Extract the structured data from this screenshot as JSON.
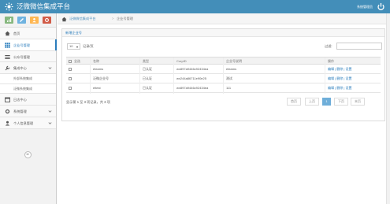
{
  "header": {
    "brand": "泛微微信集成平台",
    "user": "系统管理员",
    "colors": {
      "topbar": "#438eb9",
      "accent": "#2b7dbc"
    }
  },
  "sidebar": {
    "shortcuts": [
      {
        "icon": "signal-icon",
        "color": "#87b87f"
      },
      {
        "icon": "pencil-icon",
        "color": "#6fb3e0"
      },
      {
        "icon": "users-icon",
        "color": "#ffb752"
      },
      {
        "icon": "gear-icon",
        "color": "#d15b47"
      }
    ],
    "items": [
      {
        "label": "首页",
        "icon": "home-icon"
      },
      {
        "label": "企业号管理",
        "icon": "grid-icon",
        "active": true
      },
      {
        "label": "公众号管理",
        "icon": "list-icon"
      },
      {
        "label": "集成中心",
        "icon": "wrench-icon",
        "expanded": true
      },
      {
        "label": "外部系统集成"
      },
      {
        "label": "泛微系统集成"
      },
      {
        "label": "日志中心",
        "icon": "calendar-icon"
      },
      {
        "label": "系统管理",
        "icon": "gear-icon"
      },
      {
        "label": "个人信息管理",
        "icon": "user-icon"
      }
    ]
  },
  "breadcrumb": {
    "root": "泛微微信集成平台",
    "separator": ">",
    "current": "企业号管理"
  },
  "panel": {
    "title": "新增企业号",
    "length_value": "10",
    "length_suffix": "记录/页",
    "filter_label": "过滤:",
    "columns": [
      "全选",
      "名称",
      "类型",
      "CorpID",
      "企业号说明",
      "操作"
    ],
    "rows": [
      {
        "name": "eteams",
        "type": "已认证",
        "corpid": "wx897a9446c92434ea",
        "desc": "eteams",
        "ops": "编辑 | 删除 | 设置"
      },
      {
        "name": "泛微企业号",
        "type": "已认证",
        "corpid": "wx244a86711e90e25",
        "desc": "测试",
        "ops": "编辑 | 删除 | 设置"
      },
      {
        "name": "eitest",
        "type": "已认证",
        "corpid": "wx897a9446c92434ea",
        "desc": "111",
        "ops": "编辑 | 删除 | 设置"
      }
    ],
    "info": "显示第 1 至 3 项记录，共 3 项",
    "pagination": [
      "首页",
      "上页",
      "1",
      "下页",
      "末页"
    ],
    "current_page": "1"
  }
}
